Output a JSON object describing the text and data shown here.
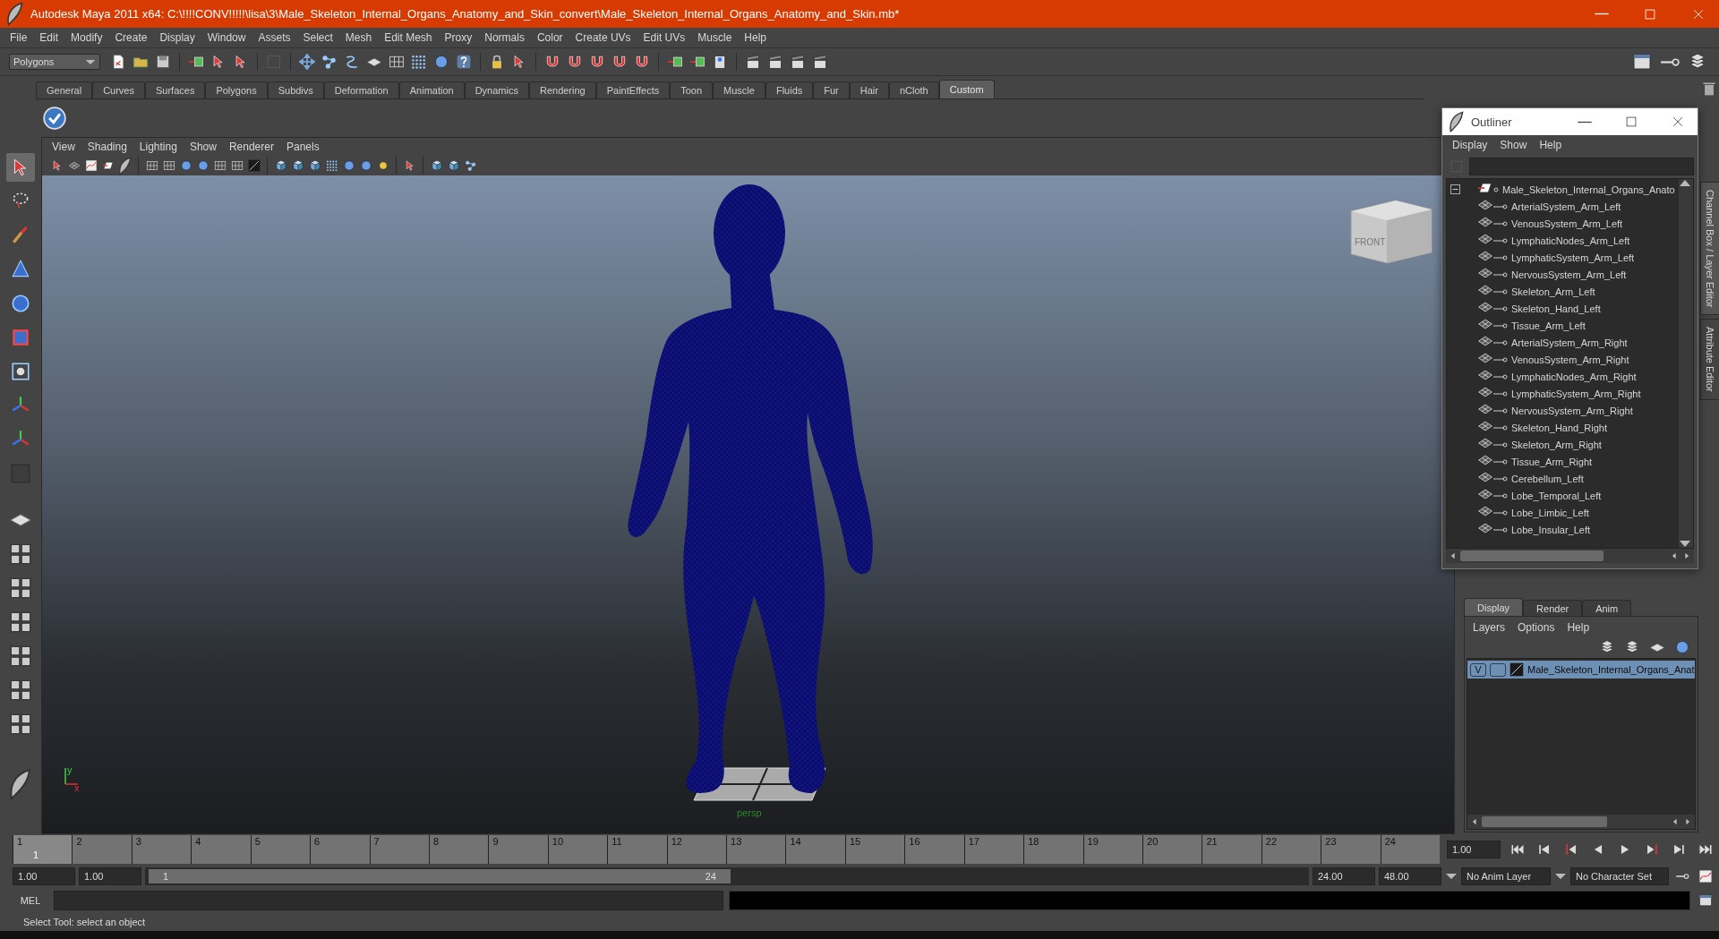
{
  "window": {
    "title": "Autodesk Maya 2011 x64: C:\\!!!!CONV!!!!!\\lisa\\3\\Male_Skeleton_Internal_Organs_Anatomy_and_Skin_convert\\Male_Skeleton_Internal_Organs_Anatomy_and_Skin.mb*"
  },
  "menu_bar": [
    "File",
    "Edit",
    "Modify",
    "Create",
    "Display",
    "Window",
    "Assets",
    "Select",
    "Mesh",
    "Edit Mesh",
    "Proxy",
    "Normals",
    "Color",
    "Create UVs",
    "Edit UVs",
    "Muscle",
    "Help"
  ],
  "toolbar": {
    "mode": "Polygons"
  },
  "shelf": {
    "tabs": [
      {
        "label": "General",
        "selected": false
      },
      {
        "label": "Curves",
        "selected": false
      },
      {
        "label": "Surfaces",
        "selected": false
      },
      {
        "label": "Polygons",
        "selected": false
      },
      {
        "label": "Subdivs",
        "selected": false
      },
      {
        "label": "Deformation",
        "selected": false
      },
      {
        "label": "Animation",
        "selected": false
      },
      {
        "label": "Dynamics",
        "selected": false
      },
      {
        "label": "Rendering",
        "selected": false
      },
      {
        "label": "PaintEffects",
        "selected": false
      },
      {
        "label": "Toon",
        "selected": false
      },
      {
        "label": "Muscle",
        "selected": false
      },
      {
        "label": "Fluids",
        "selected": false
      },
      {
        "label": "Fur",
        "selected": false
      },
      {
        "label": "Hair",
        "selected": false
      },
      {
        "label": "nCloth",
        "selected": false
      },
      {
        "label": "Custom",
        "selected": true
      }
    ]
  },
  "viewport": {
    "menus": [
      "View",
      "Shading",
      "Lighting",
      "Show",
      "Renderer",
      "Panels"
    ],
    "view_cube": "FRONT",
    "camera": "persp",
    "axis": [
      "y",
      "x"
    ]
  },
  "outliner": {
    "title": "Outliner",
    "menus": [
      "Display",
      "Show",
      "Help"
    ],
    "tree": [
      {
        "label": "Male_Skeleton_Internal_Organs_Anato",
        "expanded": true,
        "children": [
          {
            "label": "ArterialSystem_Arm_Left"
          },
          {
            "label": "VenousSystem_Arm_Left"
          },
          {
            "label": "LymphaticNodes_Arm_Left"
          },
          {
            "label": "LymphaticSystem_Arm_Left"
          },
          {
            "label": "NervousSystem_Arm_Left"
          },
          {
            "label": "Skeleton_Arm_Left"
          },
          {
            "label": "Skeleton_Hand_Left"
          },
          {
            "label": "Tissue_Arm_Left"
          },
          {
            "label": "ArterialSystem_Arm_Right"
          },
          {
            "label": "VenousSystem_Arm_Right"
          },
          {
            "label": "LymphaticNodes_Arm_Right"
          },
          {
            "label": "LymphaticSystem_Arm_Right"
          },
          {
            "label": "NervousSystem_Arm_Right"
          },
          {
            "label": "Skeleton_Hand_Right"
          },
          {
            "label": "Skeleton_Arm_Right"
          },
          {
            "label": "Tissue_Arm_Right"
          },
          {
            "label": "Cerebellum_Left"
          },
          {
            "label": "Lobe_Temporal_Left"
          },
          {
            "label": "Lobe_Limbic_Left"
          },
          {
            "label": "Lobe_Insular_Left"
          }
        ]
      }
    ]
  },
  "side_tabs": [
    {
      "label": "Channel Box / Layer Editor",
      "selected": true
    },
    {
      "label": "Attribute Editor",
      "selected": false
    }
  ],
  "layer_editor": {
    "tabs": [
      {
        "label": "Display",
        "selected": true
      },
      {
        "label": "Render",
        "selected": false
      },
      {
        "label": "Anim",
        "selected": false
      }
    ],
    "menus": [
      "Layers",
      "Options",
      "Help"
    ],
    "layers": [
      {
        "name": "Male_Skeleton_Internal_Organs_Anat",
        "visibility": "V",
        "selected": true
      }
    ]
  },
  "time_slider": {
    "frames": [
      "1",
      "2",
      "3",
      "4",
      "5",
      "6",
      "7",
      "8",
      "9",
      "10",
      "11",
      "12",
      "13",
      "14",
      "15",
      "16",
      "17",
      "18",
      "19",
      "20",
      "21",
      "22",
      "23",
      "24"
    ],
    "current_frame": "1",
    "current_time": "1.00"
  },
  "range_slider": {
    "start_time": "1.00",
    "playback_start": "1.00",
    "range_start": "1",
    "range_end": "24",
    "playback_end": "24.00",
    "end_time": "48.00",
    "anim_layer": "No Anim Layer",
    "character_set": "No Character Set"
  },
  "command_line": {
    "label": "MEL"
  },
  "help_line": "Select Tool: select an object"
}
